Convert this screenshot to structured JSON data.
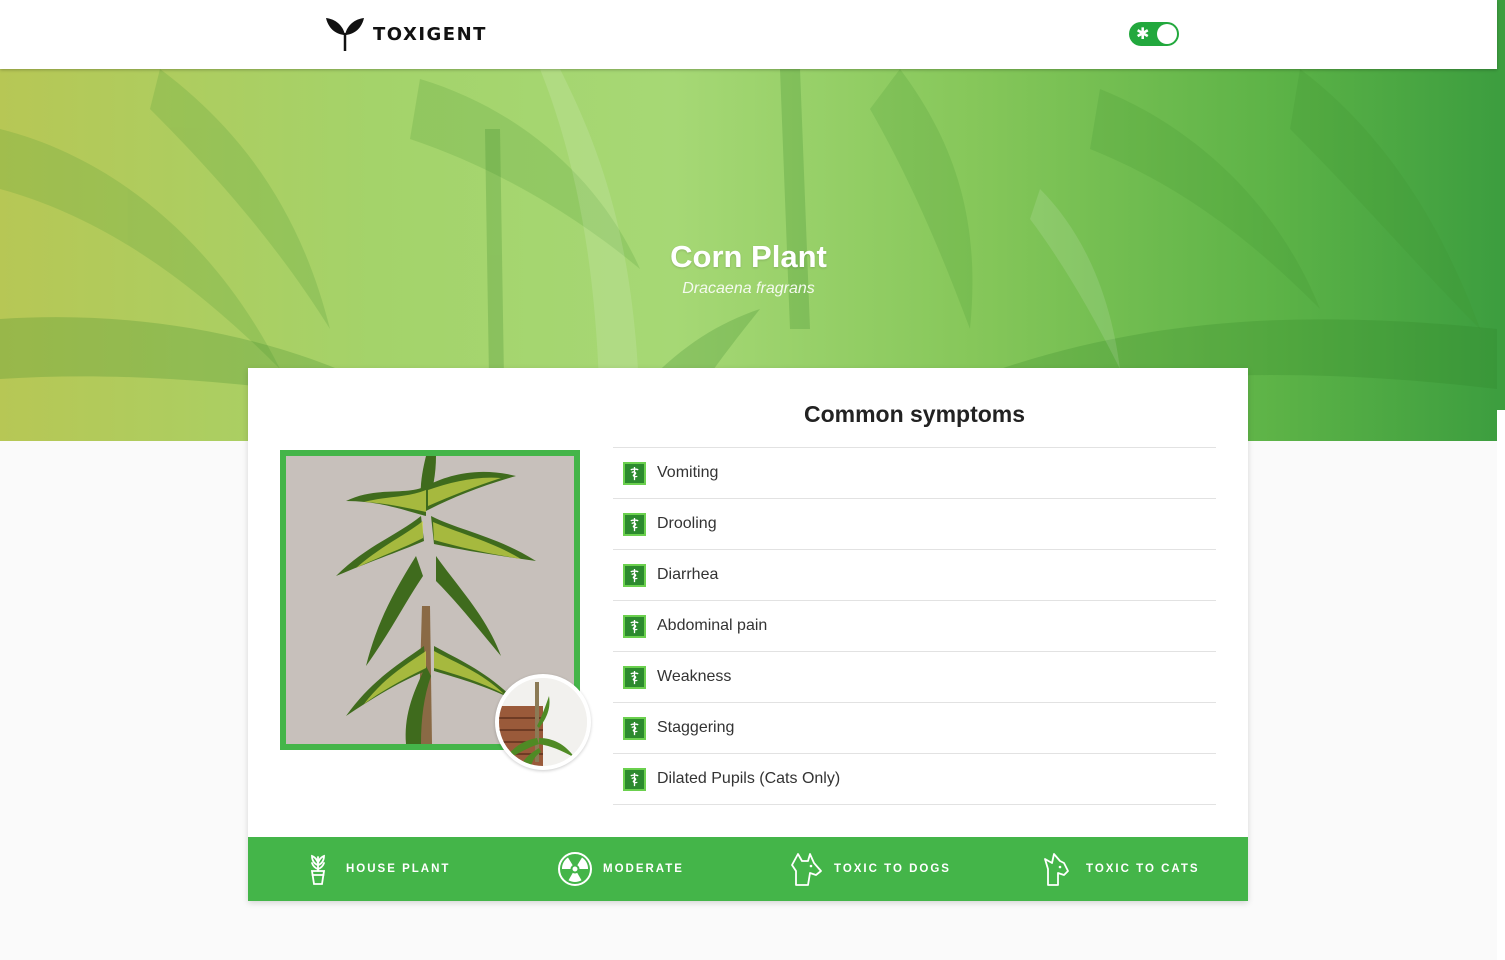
{
  "header": {
    "brand": "TOXIGENT",
    "logo_icon": "sprout-icon",
    "theme_toggle": {
      "icon": "sun-icon",
      "on": true,
      "color": "#22a83d"
    }
  },
  "hero": {
    "title": "Corn Plant",
    "subtitle": "Dracaena fragrans"
  },
  "symptoms": {
    "title": "Common symptoms",
    "icon": "caduceus-icon",
    "items": [
      {
        "label": "Vomiting"
      },
      {
        "label": "Drooling"
      },
      {
        "label": "Diarrhea"
      },
      {
        "label": "Abdominal pain"
      },
      {
        "label": "Weakness"
      },
      {
        "label": "Staggering"
      },
      {
        "label": "Dilated Pupils (Cats Only)"
      }
    ]
  },
  "tags": [
    {
      "icon": "potted-plant-icon",
      "label": "HOUSE PLANT"
    },
    {
      "icon": "radiation-icon",
      "label": "MODERATE"
    },
    {
      "icon": "dog-icon",
      "label": "TOXIC TO DOGS"
    },
    {
      "icon": "cat-icon",
      "label": "TOXIC TO CATS"
    }
  ],
  "colors": {
    "accent": "#44b549",
    "accent_dark": "#2c8a2e"
  }
}
